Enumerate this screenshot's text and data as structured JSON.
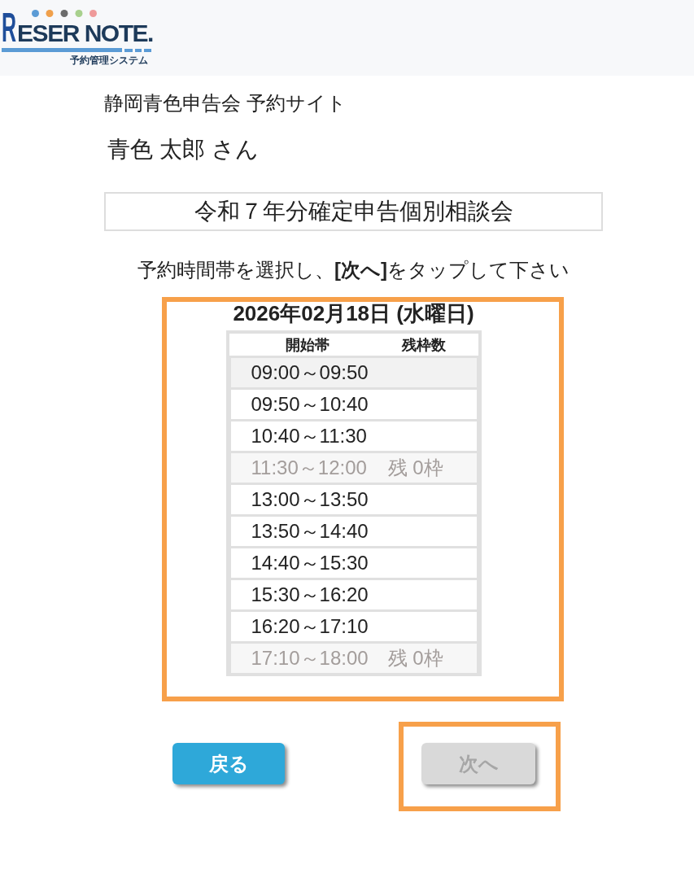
{
  "header": {
    "logo": {
      "wordmark": "RESER NOTE.",
      "tagline": "予約管理システム"
    }
  },
  "site_title": "静岡青色申告会 予約サイト",
  "user_name": "青色 太郎 さん",
  "event_title": "令和７年分確定申告個別相談会",
  "instruction": "予約時間帯を選択し、**[次へ]**をタップして下さい",
  "slot_panel": {
    "highlighted": true,
    "date": "2026年02月18日 (水曜日)",
    "columns": [
      "開始帯",
      "残枠数"
    ],
    "slots": [
      {
        "time": "09:00～09:50",
        "disabled": false,
        "hovered": true
      },
      {
        "time": "09:50～10:40",
        "disabled": false,
        "hovered": false
      },
      {
        "time": "10:40～11:30",
        "disabled": false,
        "hovered": false
      },
      {
        "time": "11:30～12:00",
        "remaining": "残 0枠",
        "disabled": true,
        "hovered": false
      },
      {
        "time": "13:00～13:50",
        "disabled": false,
        "hovered": false
      },
      {
        "time": "13:50～14:40",
        "disabled": false,
        "hovered": false
      },
      {
        "time": "14:40～15:30",
        "disabled": false,
        "hovered": false
      },
      {
        "time": "15:30～16:20",
        "disabled": false,
        "hovered": false
      },
      {
        "time": "16:20～17:10",
        "disabled": false,
        "hovered": false
      },
      {
        "time": "17:10～18:00",
        "remaining": "残 0枠",
        "disabled": true,
        "hovered": false
      }
    ]
  },
  "buttons": [
    {
      "label": "戻る",
      "kind": "back",
      "disabled": false,
      "highlighted": false
    },
    {
      "label": "次へ",
      "kind": "next",
      "disabled": true,
      "highlighted": true
    }
  ]
}
